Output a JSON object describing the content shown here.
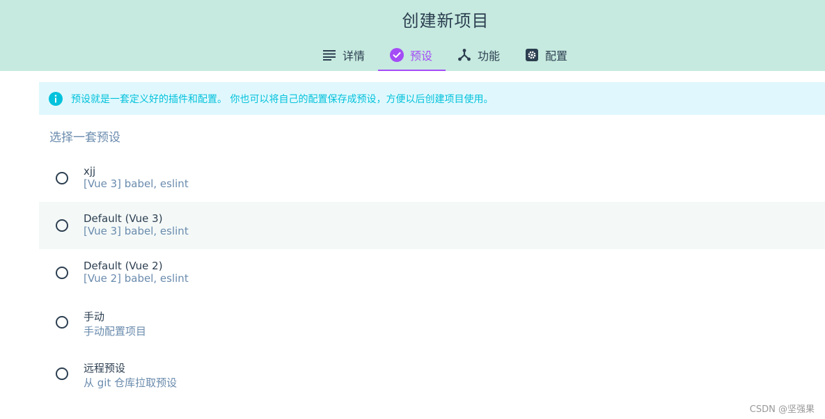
{
  "page": {
    "title": "创建新项目"
  },
  "tabs": [
    {
      "label": "详情",
      "icon": "details-list-icon",
      "active": false
    },
    {
      "label": "预设",
      "icon": "check-circle-icon",
      "active": true
    },
    {
      "label": "功能",
      "icon": "features-fork-icon",
      "active": false
    },
    {
      "label": "配置",
      "icon": "settings-gear-icon",
      "active": false
    }
  ],
  "notice": {
    "icon": "info-icon",
    "text": "预设就是一套定义好的插件和配置。 你也可以将自己的配置保存成预设，方便以后创建项目使用。"
  },
  "presets_section": {
    "label": "选择一套预设",
    "items": [
      {
        "name": "xjj",
        "description": "[Vue 3] babel, eslint"
      },
      {
        "name": "Default (Vue 3)",
        "description": "[Vue 3] babel, eslint"
      },
      {
        "name": "Default (Vue 2)",
        "description": "[Vue 2] babel, eslint"
      },
      {
        "name": "手动",
        "description": "手动配置项目"
      },
      {
        "name": "远程预设",
        "description": "从 git 仓库拉取预设"
      }
    ]
  },
  "watermark": "CSDN @坚强果",
  "colors": {
    "header_bg": "#c6eadf",
    "accent": "#a44cf6",
    "notice_bg": "#e0f8fd",
    "notice_text": "#03c2dc",
    "text_primary": "#2c3e50",
    "text_secondary": "#6a8bad"
  }
}
